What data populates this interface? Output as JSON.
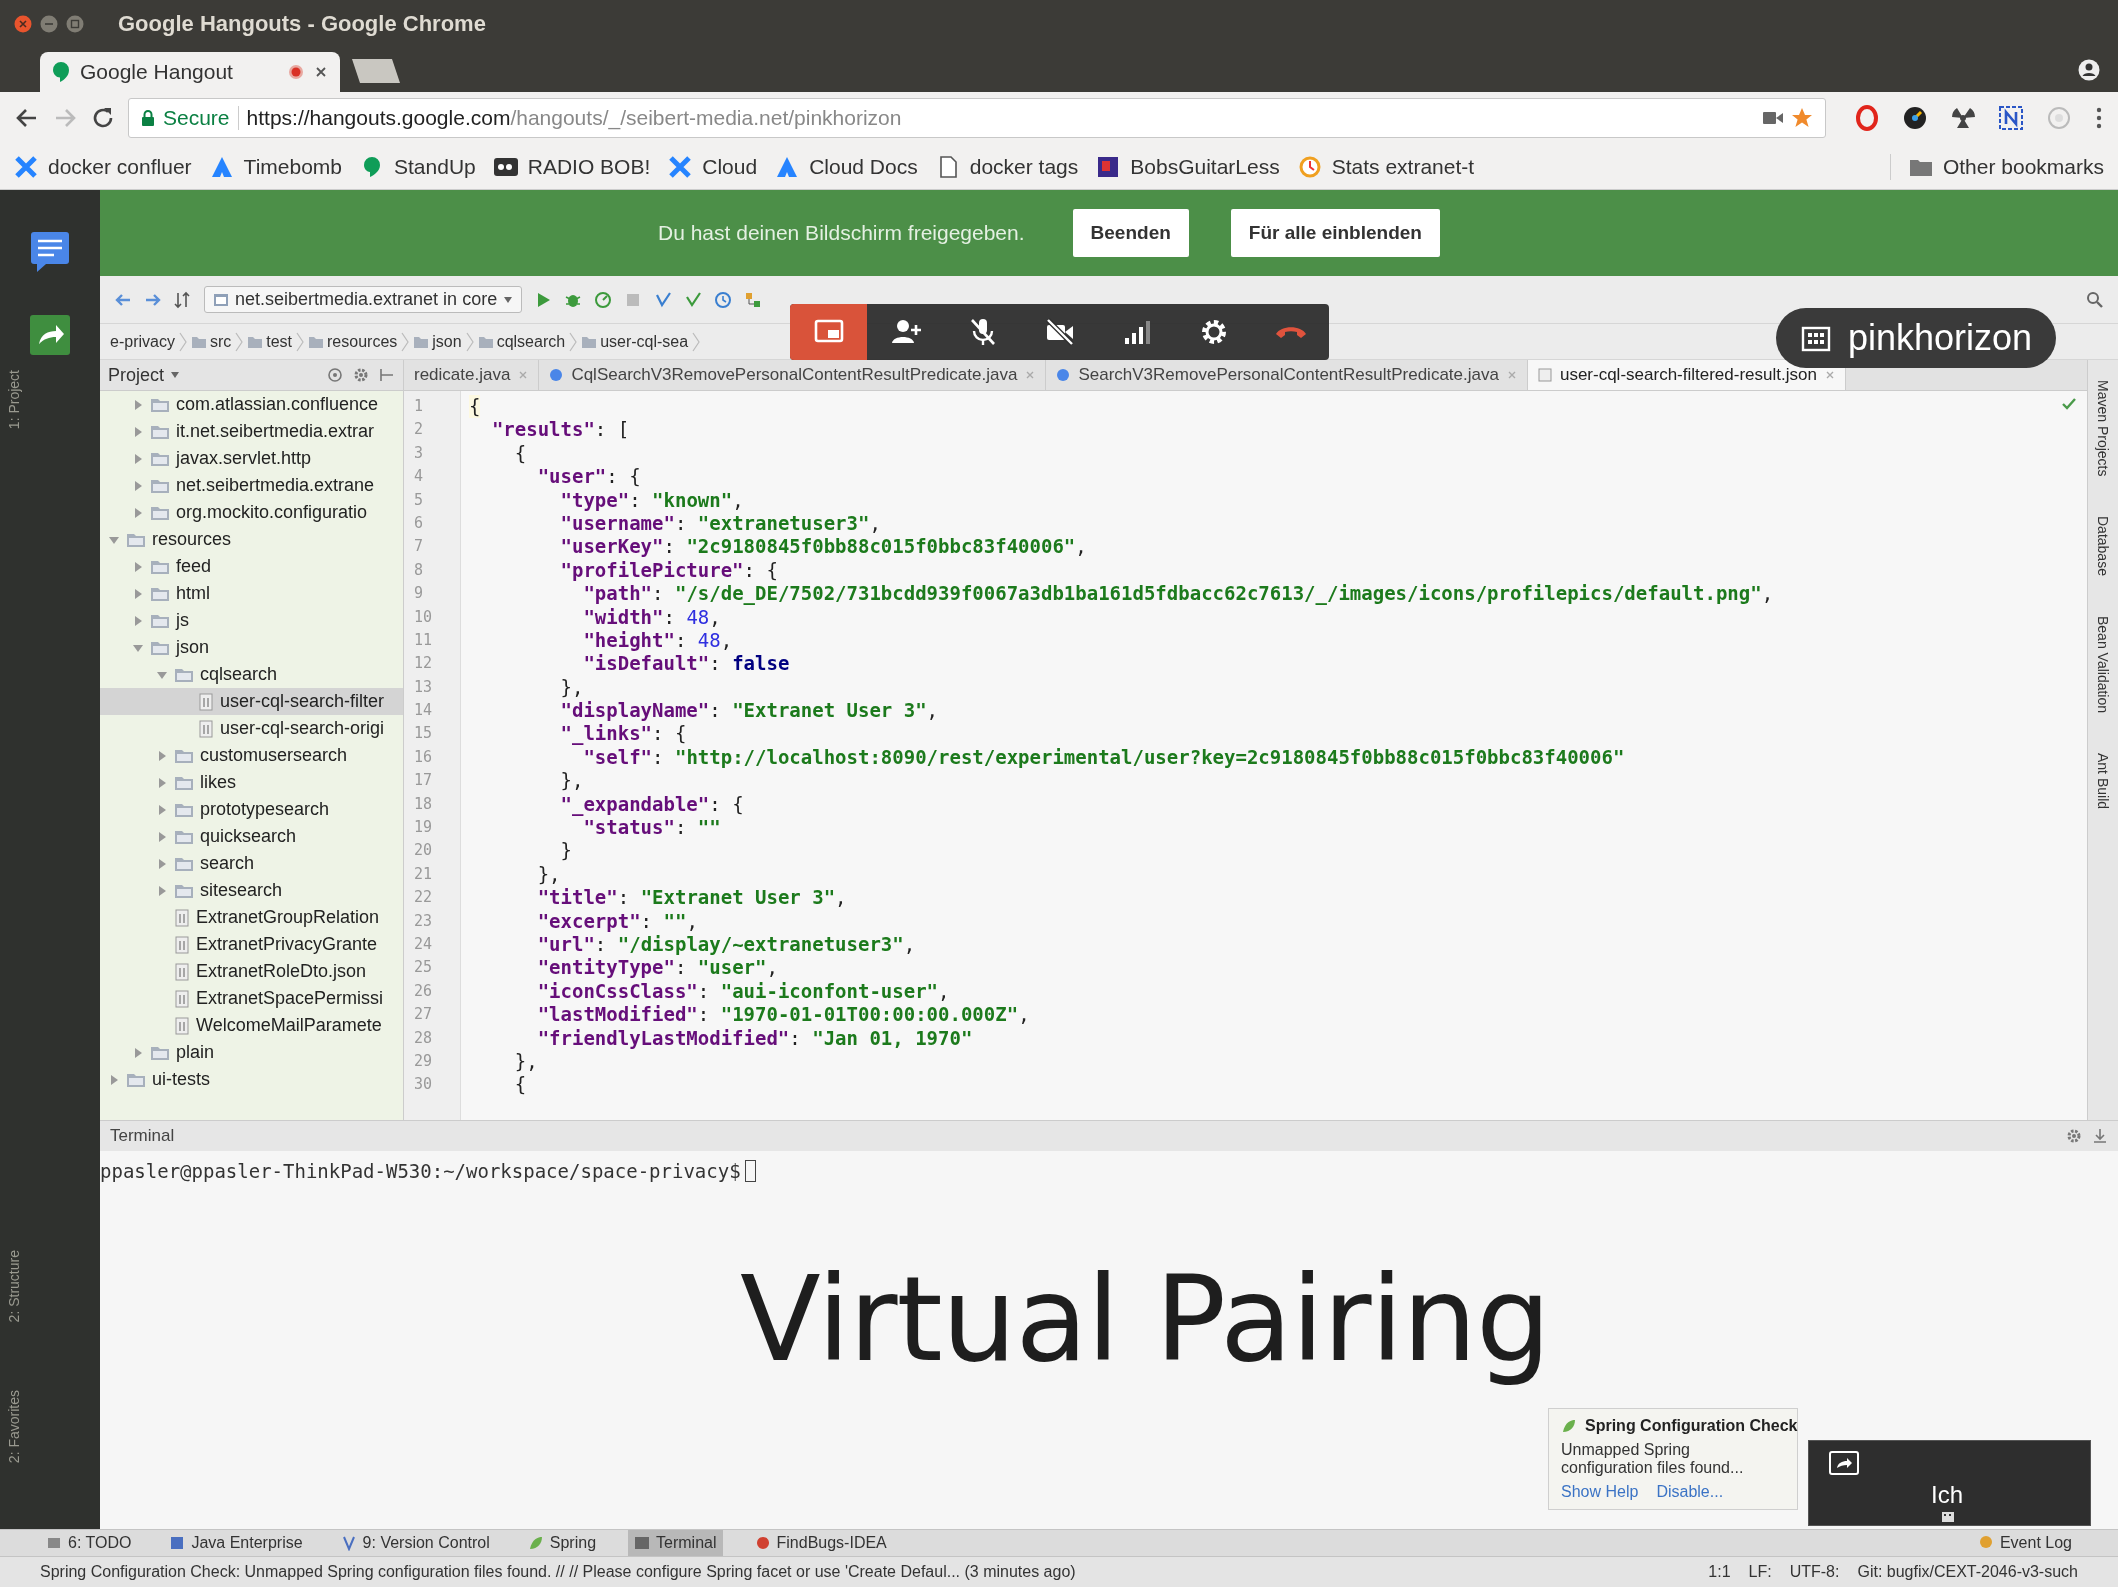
{
  "window": {
    "title": "Google Hangouts - Google Chrome"
  },
  "browser_tabs": [
    {
      "title": "Google Hangout",
      "selected": true
    }
  ],
  "address_bar": {
    "security": "Secure",
    "url_host": "https://hangouts.google.com",
    "url_path": "/hangouts/_/seibert-media.net/pinkhorizon"
  },
  "bookmarks": [
    {
      "label": "docker confluer"
    },
    {
      "label": "Timebomb"
    },
    {
      "label": "StandUp"
    },
    {
      "label": "RADIO BOB!"
    },
    {
      "label": "Cloud"
    },
    {
      "label": "Cloud Docs"
    },
    {
      "label": "docker tags"
    },
    {
      "label": "BobsGuitarLess"
    },
    {
      "label": "Stats extranet-t"
    }
  ],
  "other_bookmarks": "Other bookmarks",
  "share_banner": {
    "message": "Du hast deinen Bildschirm freigegeben.",
    "buttons": [
      "Beenden",
      "Für alle einblenden"
    ]
  },
  "call": {
    "controls": [
      {
        "selected": true
      },
      {
        "selected": false
      },
      {
        "selected": false
      },
      {
        "selected": false
      },
      {
        "selected": false
      },
      {
        "selected": false
      },
      {
        "selected": false
      }
    ],
    "room": "pinkhorizon",
    "self_view": "Ich"
  },
  "ide": {
    "run_config": "net.seibertmedia.extranet in core",
    "breadcrumbs": [
      "e-privacy",
      "src",
      "test",
      "resources",
      "json",
      "cqlsearch",
      "user-cql-sea"
    ],
    "left_tool_windows": [
      "1: Project",
      "2: Structure",
      "2: Favorites"
    ],
    "right_tool_windows": [
      "Maven Projects",
      "Database",
      "Bean Validation",
      "Ant Build"
    ],
    "project_panel": {
      "title": "Project",
      "tree": [
        {
          "children": [
            {
              "label": "com.atlassian.confluence",
              "kind": "folder",
              "expanded": false,
              "selected": false
            },
            {
              "label": "it.net.seibertmedia.extrar",
              "kind": "folder",
              "expanded": false,
              "selected": false
            },
            {
              "label": "javax.servlet.http",
              "kind": "folder",
              "expanded": false,
              "selected": false
            },
            {
              "label": "net.seibertmedia.extrane",
              "kind": "folder",
              "expanded": false,
              "selected": false
            },
            {
              "label": "org.mockito.configuratio",
              "kind": "folder",
              "expanded": false,
              "selected": false
            }
          ]
        },
        {
          "label": "resources",
          "kind": "folder",
          "expanded": true,
          "selected": false,
          "children": [
            {
              "label": "feed",
              "kind": "folder",
              "expanded": false,
              "selected": false
            },
            {
              "label": "html",
              "kind": "folder",
              "expanded": false,
              "selected": false
            },
            {
              "label": "js",
              "kind": "folder",
              "expanded": false,
              "selected": false
            },
            {
              "label": "json",
              "kind": "folder",
              "expanded": true,
              "selected": false,
              "children": [
                {
                  "label": "cqlsearch",
                  "kind": "folder",
                  "expanded": true,
                  "selected": false,
                  "children": [
                    {
                      "label": "user-cql-search-filter",
                      "kind": "file",
                      "selected": true
                    },
                    {
                      "label": "user-cql-search-origi",
                      "kind": "file",
                      "selected": false
                    }
                  ]
                },
                {
                  "label": "customusersearch",
                  "kind": "folder",
                  "expanded": false,
                  "selected": false
                },
                {
                  "label": "likes",
                  "kind": "folder",
                  "expanded": false,
                  "selected": false
                },
                {
                  "label": "prototypesearch",
                  "kind": "folder",
                  "expanded": false,
                  "selected": false
                },
                {
                  "label": "quicksearch",
                  "kind": "folder",
                  "expanded": false,
                  "selected": false
                },
                {
                  "label": "search",
                  "kind": "folder",
                  "expanded": false,
                  "selected": false
                },
                {
                  "label": "sitesearch",
                  "kind": "folder",
                  "expanded": false,
                  "selected": false
                },
                {
                  "label": "ExtranetGroupRelation",
                  "kind": "file",
                  "selected": false
                },
                {
                  "label": "ExtranetPrivacyGrante",
                  "kind": "file",
                  "selected": false
                },
                {
                  "label": "ExtranetRoleDto.json",
                  "kind": "file",
                  "selected": false
                },
                {
                  "label": "ExtranetSpacePermissi",
                  "kind": "file",
                  "selected": false
                },
                {
                  "label": "WelcomeMailParamete",
                  "kind": "file",
                  "selected": false
                }
              ]
            },
            {
              "label": "plain",
              "kind": "folder",
              "expanded": false,
              "selected": false
            }
          ]
        },
        {
          "label": "ui-tests",
          "kind": "folder",
          "expanded": false,
          "selected": false
        }
      ]
    },
    "editor_tabs": [
      {
        "label": "redicate.java",
        "selected": false
      },
      {
        "label": "CqlSearchV3RemovePersonalContentResultPredicate.java",
        "selected": false
      },
      {
        "label": "SearchV3RemovePersonalContentResultPredicate.java",
        "selected": false
      },
      {
        "label": "user-cql-search-filtered-result.json",
        "selected": true
      }
    ],
    "code_lines": [
      {
        "n": "1",
        "text": "{"
      },
      {
        "n": "2",
        "text": "  \"results\": ["
      },
      {
        "n": "3",
        "text": "    {"
      },
      {
        "n": "4",
        "text": "      \"user\": {"
      },
      {
        "n": "5",
        "text": "        \"type\": \"known\","
      },
      {
        "n": "6",
        "text": "        \"username\": \"extranetuser3\","
      },
      {
        "n": "7",
        "text": "        \"userKey\": \"2c9180845f0bb88c015f0bbc83f40006\","
      },
      {
        "n": "8",
        "text": "        \"profilePicture\": {"
      },
      {
        "n": "9",
        "text": "          \"path\": \"/s/de_DE/7502/731bcdd939f0067a3db1ba161d5fdbacc62c7613/_/images/icons/profilepics/default.png\","
      },
      {
        "n": "10",
        "text": "          \"width\": 48,"
      },
      {
        "n": "11",
        "text": "          \"height\": 48,"
      },
      {
        "n": "12",
        "text": "          \"isDefault\": false"
      },
      {
        "n": "13",
        "text": "        },"
      },
      {
        "n": "14",
        "text": "        \"displayName\": \"Extranet User 3\","
      },
      {
        "n": "15",
        "text": "        \"_links\": {"
      },
      {
        "n": "16",
        "text": "          \"self\": \"http://localhost:8090/rest/experimental/user?key=2c9180845f0bb88c015f0bbc83f40006\""
      },
      {
        "n": "17",
        "text": "        },"
      },
      {
        "n": "18",
        "text": "        \"_expandable\": {"
      },
      {
        "n": "19",
        "text": "          \"status\": \"\""
      },
      {
        "n": "20",
        "text": "        }"
      },
      {
        "n": "21",
        "text": "      },"
      },
      {
        "n": "22",
        "text": "      \"title\": \"Extranet User 3\","
      },
      {
        "n": "23",
        "text": "      \"excerpt\": \"\","
      },
      {
        "n": "24",
        "text": "      \"url\": \"/display/~extranetuser3\","
      },
      {
        "n": "25",
        "text": "      \"entityType\": \"user\","
      },
      {
        "n": "26",
        "text": "      \"iconCssClass\": \"aui-iconfont-user\","
      },
      {
        "n": "27",
        "text": "      \"lastModified\": \"1970-01-01T00:00:00.000Z\","
      },
      {
        "n": "28",
        "text": "      \"friendlyLastModified\": \"Jan 01, 1970\""
      },
      {
        "n": "29",
        "text": "    },"
      },
      {
        "n": "30",
        "text": "    {"
      }
    ],
    "terminal": {
      "title": "Terminal",
      "prompt": "ppasler@ppasler-ThinkPad-W530:~/workspace/space-privacy$"
    },
    "overlay_title": "Virtual Pairing",
    "notification": {
      "title": "Spring Configuration Check",
      "message": "Unmapped Spring configuration files found...",
      "links": [
        "Show Help",
        "Disable..."
      ]
    },
    "tool_windows": [
      {
        "label": "6: TODO",
        "selected": false
      },
      {
        "label": "Java Enterprise",
        "selected": false
      },
      {
        "label": "9: Version Control",
        "selected": false
      },
      {
        "label": "Spring",
        "selected": false
      },
      {
        "label": "Terminal",
        "selected": true
      },
      {
        "label": "FindBugs-IDEA",
        "selected": false
      }
    ],
    "event_log": "Event Log",
    "status_bar": {
      "message": "Spring Configuration Check: Unmapped Spring configuration files found. // // Please configure Spring facet or use 'Create Defaul... (3 minutes ago)",
      "position": "1:1",
      "line_separator": "LF:",
      "encoding": "UTF-8:",
      "vcs": "Git: bugfix/CEXT-2046-v3-such"
    }
  }
}
